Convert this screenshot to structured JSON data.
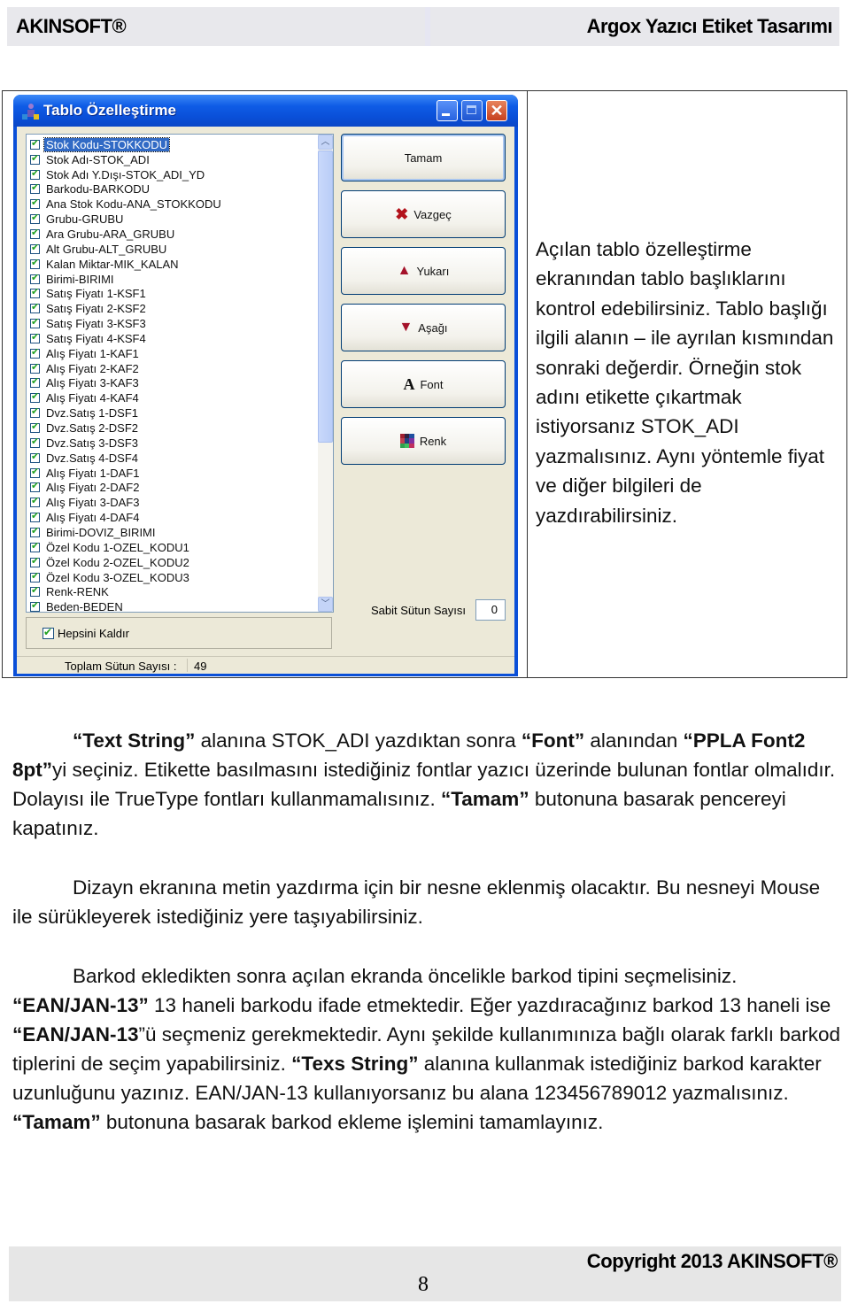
{
  "header": {
    "brand": "AKINSOFT®",
    "doc_title": "Argox Yazıcı Etiket Tasarımı"
  },
  "window": {
    "title": "Tablo Özelleştirme",
    "controls": {
      "minimize": "minimize",
      "maximize": "maximize",
      "close": "✕"
    },
    "columns": [
      {
        "label": "Stok Kodu-STOKKODU",
        "checked": true,
        "selected": true
      },
      {
        "label": "Stok Adı-STOK_ADI",
        "checked": true
      },
      {
        "label": "Stok Adı Y.Dışı-STOK_ADI_YD",
        "checked": true
      },
      {
        "label": "Barkodu-BARKODU",
        "checked": true
      },
      {
        "label": "Ana Stok Kodu-ANA_STOKKODU",
        "checked": true
      },
      {
        "label": "Grubu-GRUBU",
        "checked": true
      },
      {
        "label": "Ara Grubu-ARA_GRUBU",
        "checked": true
      },
      {
        "label": "Alt Grubu-ALT_GRUBU",
        "checked": true
      },
      {
        "label": "Kalan Miktar-MIK_KALAN",
        "checked": true
      },
      {
        "label": "Birimi-BIRIMI",
        "checked": true
      },
      {
        "label": "Satış Fiyatı 1-KSF1",
        "checked": true
      },
      {
        "label": "Satış Fiyatı 2-KSF2",
        "checked": true
      },
      {
        "label": "Satış Fiyatı 3-KSF3",
        "checked": true
      },
      {
        "label": "Satış Fiyatı 4-KSF4",
        "checked": true
      },
      {
        "label": "Alış Fiyatı 1-KAF1",
        "checked": true
      },
      {
        "label": "Alış Fiyatı 2-KAF2",
        "checked": true
      },
      {
        "label": "Alış Fiyatı 3-KAF3",
        "checked": true
      },
      {
        "label": "Alış Fiyatı 4-KAF4",
        "checked": true
      },
      {
        "label": "Dvz.Satış 1-DSF1",
        "checked": true
      },
      {
        "label": "Dvz.Satış 2-DSF2",
        "checked": true
      },
      {
        "label": "Dvz.Satış 3-DSF3",
        "checked": true
      },
      {
        "label": "Dvz.Satış 4-DSF4",
        "checked": true
      },
      {
        "label": "Alış Fiyatı 1-DAF1",
        "checked": true
      },
      {
        "label": "Alış Fiyatı 2-DAF2",
        "checked": true
      },
      {
        "label": "Alış Fiyatı 3-DAF3",
        "checked": true
      },
      {
        "label": "Alış Fiyatı 4-DAF4",
        "checked": true
      },
      {
        "label": "Birimi-DOVIZ_BIRIMI",
        "checked": true
      },
      {
        "label": "Özel Kodu 1-OZEL_KODU1",
        "checked": true
      },
      {
        "label": "Özel Kodu 2-OZEL_KODU2",
        "checked": true
      },
      {
        "label": "Özel Kodu 3-OZEL_KODU3",
        "checked": true
      },
      {
        "label": "Renk-RENK",
        "checked": true
      },
      {
        "label": "Beden-BEDEN",
        "checked": true
      }
    ],
    "buttons": {
      "ok": "Tamam",
      "cancel": "Vazgeç",
      "up": "Yukarı",
      "down": "Aşağı",
      "font": "Font",
      "color": "Renk"
    },
    "icons": {
      "up": "▲",
      "down": "▼",
      "cancel": "✖",
      "font": "A",
      "scroll_up": "︿",
      "scroll_down": "﹀"
    },
    "fixed_columns_label": "Sabit Sütun Sayısı",
    "fixed_columns_value": "0",
    "select_all_label": "Hepsini Kaldır",
    "total_columns_label": "Toplam Sütun Sayısı :",
    "total_columns_value": "49"
  },
  "side_note": "Açılan tablo özelleştirme ekranından tablo başlıklarını kontrol edebilirsiniz. Tablo başlığı ilgili alanın – ile ayrılan kısmından sonraki değerdir. Örneğin stok adını etikette çıkartmak istiyorsanız STOK_ADI yazmalısınız. Aynı yöntemle fiyat ve diğer bilgileri de yazdırabilirsiniz.",
  "paragraphs": {
    "p1": [
      {
        "t": "“Text String”",
        "b": true
      },
      {
        "t": " alanına STOK_ADI yazdıktan sonra "
      },
      {
        "t": "“Font”",
        "b": true
      },
      {
        "t": " alanından "
      },
      {
        "t": "“PPLA Font2 8pt”",
        "b": true
      },
      {
        "t": "yi seçiniz. Etikette basılmasını istediğiniz fontlar yazıcı üzerinde bulunan fontlar olmalıdır. Dolayısı ile TrueType fontları kullanmamalısınız. "
      },
      {
        "t": "“Tamam”",
        "b": true
      },
      {
        "t": " butonuna basarak pencereyi kapatınız."
      }
    ],
    "p2": [
      {
        "t": "Dizayn ekranına metin yazdırma için bir nesne eklenmiş olacaktır. Bu nesneyi Mouse ile sürükleyerek istediğiniz yere taşıyabilirsiniz."
      }
    ],
    "p3": [
      {
        "t": "Barkod ekledikten sonra açılan ekranda öncelikle barkod tipini seçmelisiniz. "
      },
      {
        "t": "“EAN/JAN-13”",
        "b": true
      },
      {
        "t": " 13 haneli barkodu ifade etmektedir. Eğer yazdıracağınız barkod 13 haneli ise "
      },
      {
        "t": "“EAN/JAN-13",
        "b": true
      },
      {
        "t": "”ü seçmeniz gerekmektedir. Aynı şekilde kullanımınıza bağlı olarak farklı barkod tiplerini de seçim yapabilirsiniz. "
      },
      {
        "t": "“Texs String”",
        "b": true
      },
      {
        "t": " alanına kullanmak istediğiniz barkod karakter uzunluğunu yazınız.  EAN/JAN-13 kullanıyorsanız bu alana 123456789012 yazmalısınız. "
      },
      {
        "t": "“Tamam”",
        "b": true
      },
      {
        "t": " butonuna basarak barkod ekleme işlemini tamamlayınız."
      }
    ]
  },
  "footer": {
    "copyright": "Copyright 2013 AKINSOFT®",
    "page_number": "8"
  },
  "colors": {
    "xp_title_blue": "#0a4fd8",
    "selection_blue": "#316ac5",
    "dialog_bg": "#ece9d8",
    "check_green": "#21a121",
    "header_bg": "#e8e8ec",
    "footer_bg": "#e6e6e6"
  }
}
